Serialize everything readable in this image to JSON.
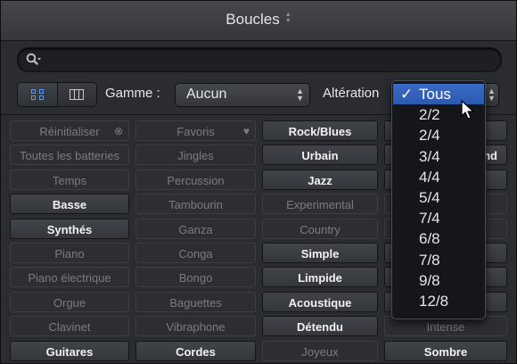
{
  "window": {
    "title": "Boucles"
  },
  "search": {
    "value": "",
    "placeholder": ""
  },
  "filters": {
    "gamme_label": "Gamme :",
    "gamme_value": "Aucun",
    "alteration_label": "Altération"
  },
  "keywords": [
    [
      {
        "label": "Réinitialiser",
        "state": "dim",
        "icon": "clear-icon"
      },
      {
        "label": "Favoris",
        "state": "dim",
        "icon": "heart-icon"
      },
      {
        "label": "Rock/Blues",
        "state": "act"
      },
      {
        "label": "",
        "state": "act"
      }
    ],
    [
      {
        "label": "Toutes les batteries",
        "state": "dim"
      },
      {
        "label": "Jingles",
        "state": "dim"
      },
      {
        "label": "Urbain",
        "state": "act"
      },
      {
        "label": "nd",
        "state": "act"
      }
    ],
    [
      {
        "label": "Temps",
        "state": "dim"
      },
      {
        "label": "Percussion",
        "state": "dim"
      },
      {
        "label": "Jazz",
        "state": "act"
      },
      {
        "label": "",
        "state": "act"
      }
    ],
    [
      {
        "label": "Basse",
        "state": "act"
      },
      {
        "label": "Tambourin",
        "state": "dim"
      },
      {
        "label": "Experimental",
        "state": "dim"
      },
      {
        "label": "",
        "state": "dim"
      }
    ],
    [
      {
        "label": "Synthés",
        "state": "act"
      },
      {
        "label": "Ganza",
        "state": "dim"
      },
      {
        "label": "Country",
        "state": "dim"
      },
      {
        "label": "",
        "state": "dim"
      }
    ],
    [
      {
        "label": "Piano",
        "state": "dim"
      },
      {
        "label": "Conga",
        "state": "dim"
      },
      {
        "label": "Simple",
        "state": "act"
      },
      {
        "label": "",
        "state": "act"
      }
    ],
    [
      {
        "label": "Piano électrique",
        "state": "dim"
      },
      {
        "label": "Bongo",
        "state": "dim"
      },
      {
        "label": "Limpide",
        "state": "act"
      },
      {
        "label": "",
        "state": "act"
      }
    ],
    [
      {
        "label": "Orgue",
        "state": "dim"
      },
      {
        "label": "Baguettes",
        "state": "dim"
      },
      {
        "label": "Acoustique",
        "state": "act"
      },
      {
        "label": "",
        "state": "act"
      }
    ],
    [
      {
        "label": "Clavinet",
        "state": "dim"
      },
      {
        "label": "Vibraphone",
        "state": "dim"
      },
      {
        "label": "Détendu",
        "state": "act"
      },
      {
        "label": "Intense",
        "state": "dim"
      }
    ],
    [
      {
        "label": "Guitares",
        "state": "act"
      },
      {
        "label": "Cordes",
        "state": "act"
      },
      {
        "label": "Joyeux",
        "state": "dim"
      },
      {
        "label": "Sombre",
        "state": "act"
      }
    ]
  ],
  "menu": {
    "check": "✓",
    "items": [
      "Tous",
      "2/2",
      "2/4",
      "3/4",
      "4/4",
      "5/4",
      "7/4",
      "6/8",
      "7/8",
      "9/8",
      "12/8"
    ],
    "selected": "Tous"
  },
  "colors": {
    "accent": "#2f5db5",
    "background": "#2a2c30"
  }
}
